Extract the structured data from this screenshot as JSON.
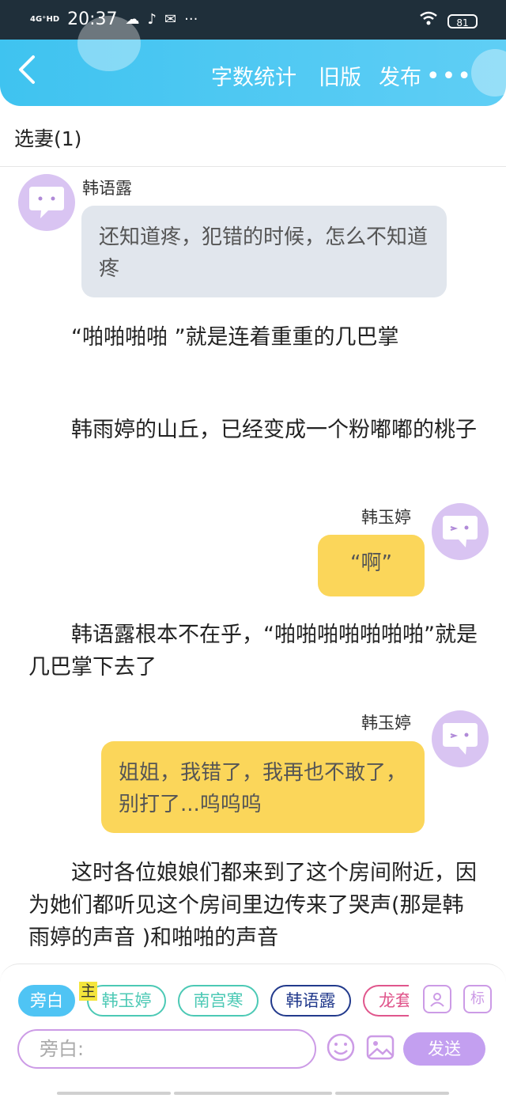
{
  "status_bar": {
    "signal": "4G⁺HD",
    "time": "20:37",
    "battery": "81",
    "more": "···"
  },
  "header": {
    "word_count": "字数统计",
    "old_version": "旧版",
    "publish": "发布",
    "more": "•••"
  },
  "chapter": {
    "title": "选妻(1)"
  },
  "messages": [
    {
      "type": "dialog",
      "side": "left",
      "speaker": "韩语露",
      "text": "还知道疼，犯错的时候，怎么不知道疼"
    },
    {
      "type": "narration",
      "text": "“啪啪啪啪 ”就是连着重重的几巴掌"
    },
    {
      "type": "narration",
      "text": "韩雨婷的山丘，已经变成一个粉嘟嘟的桃子"
    },
    {
      "type": "dialog",
      "side": "right",
      "speaker": "韩玉婷",
      "text": "“啊”"
    },
    {
      "type": "narration",
      "text": "韩语露根本不在乎，“啪啪啪啪啪啪啪”就是几巴掌下去了"
    },
    {
      "type": "dialog",
      "side": "right",
      "speaker": "韩玉婷",
      "text": "姐姐，我错了，我再也不敢了，别打了...呜呜呜"
    },
    {
      "type": "narration",
      "text": "这时各位娘娘们都来到了这个房间附近，因为她们都听见这个房间里边传来了哭声(那是韩雨婷的声音 )和啪啪的声音"
    }
  ],
  "composer": {
    "roles": [
      {
        "label": "旁白",
        "color": "#4fc4f4"
      },
      {
        "label": "韩玉婷",
        "color": "#4cc9b5"
      },
      {
        "label": "南宫寒",
        "color": "#4cc9b5"
      },
      {
        "label": "韩语露",
        "color": "#223a8c"
      },
      {
        "label": "龙套",
        "color": "#e0568c"
      }
    ],
    "main_mark": "主",
    "role_icon": "person-card-icon",
    "tag_icon_label": "标",
    "input_placeholder": "旁白:",
    "emoji_icon": "smile-icon",
    "image_icon": "image-icon",
    "send_label": "发送"
  }
}
